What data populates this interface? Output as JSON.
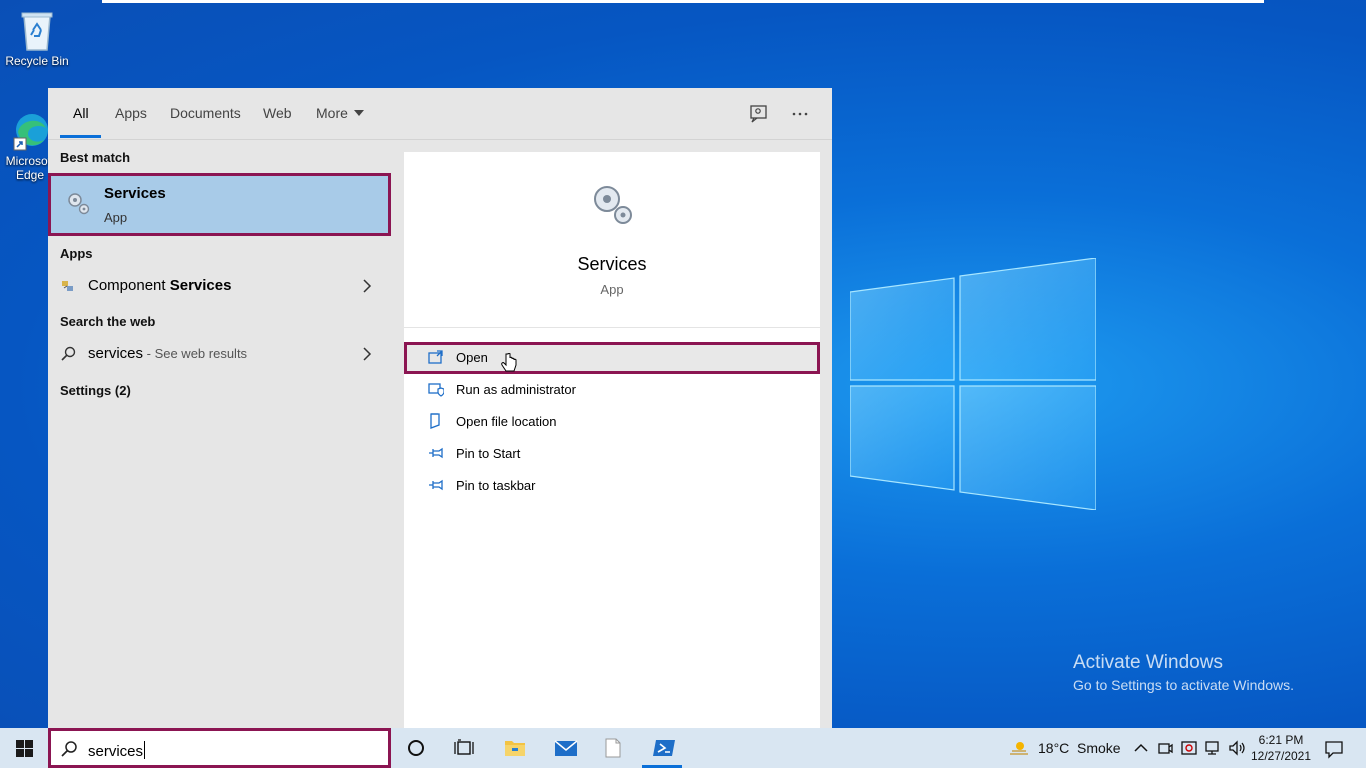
{
  "desktop": {
    "icons": [
      {
        "label": "Recycle Bin"
      },
      {
        "label": "Microsoft Edge"
      }
    ],
    "watermark": {
      "title": "Activate Windows",
      "subtitle": "Go to Settings to activate Windows."
    }
  },
  "search_panel": {
    "tabs": [
      {
        "label": "All",
        "active": true
      },
      {
        "label": "Apps"
      },
      {
        "label": "Documents"
      },
      {
        "label": "Web"
      },
      {
        "label": "More"
      }
    ],
    "toolbar_icons": [
      "feedback-icon",
      "more-options-icon"
    ],
    "left": {
      "best_match_header": "Best match",
      "best_match": {
        "name": "Services",
        "type": "App"
      },
      "apps_header": "Apps",
      "apps": [
        {
          "prefix": "Component ",
          "highlight": "Services"
        }
      ],
      "web_header": "Search the web",
      "web_result": {
        "query": "services",
        "suffix": " - See web results"
      },
      "settings_header": "Settings (2)"
    },
    "preview": {
      "name": "Services",
      "type": "App",
      "actions": [
        {
          "label": "Open",
          "icon": "open-icon",
          "selected": true
        },
        {
          "label": "Run as administrator",
          "icon": "shield-icon"
        },
        {
          "label": "Open file location",
          "icon": "folder-icon"
        },
        {
          "label": "Pin to Start",
          "icon": "pin-icon"
        },
        {
          "label": "Pin to taskbar",
          "icon": "pin-icon"
        }
      ]
    }
  },
  "taskbar": {
    "search_value": "services",
    "weather": {
      "temp": "18°C",
      "condition": "Smoke"
    },
    "clock": {
      "time": "6:21 PM",
      "date": "12/27/2021"
    },
    "accent": "#0a6fd8",
    "highlight_border": "#8b1552"
  }
}
